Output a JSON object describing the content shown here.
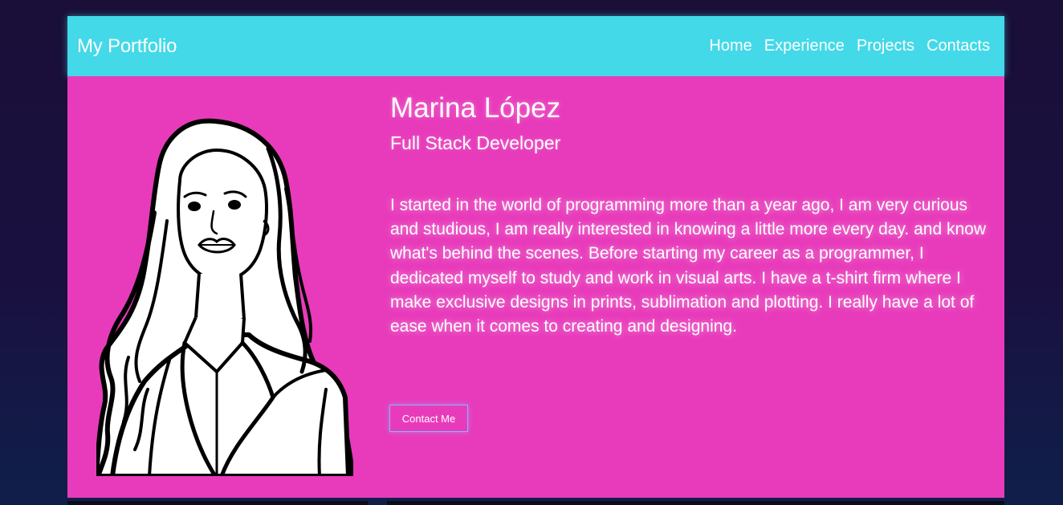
{
  "navbar": {
    "brand": "My Portfolio",
    "links": [
      "Home",
      "Experience",
      "Projects",
      "Contacts"
    ]
  },
  "hero": {
    "name": "Marina López",
    "role": "Full Stack Developer",
    "bio": "I started in the world of programming more than a year ago, I am very curious and studious, I am really interested in knowing a little more every day. and know what's behind the scenes. Before starting my career as a programmer, I dedicated myself to study and work in visual arts. I have a t-shirt firm where I make exclusive designs in prints, sublimation and plotting. I really have a lot of ease when it comes to creating and designing.",
    "button_label": "Contact Me"
  },
  "colors": {
    "navbar": "#43d9e8",
    "hero": "#e83bbb",
    "background": "#1a1040",
    "button_border": "#8fb3ff"
  }
}
